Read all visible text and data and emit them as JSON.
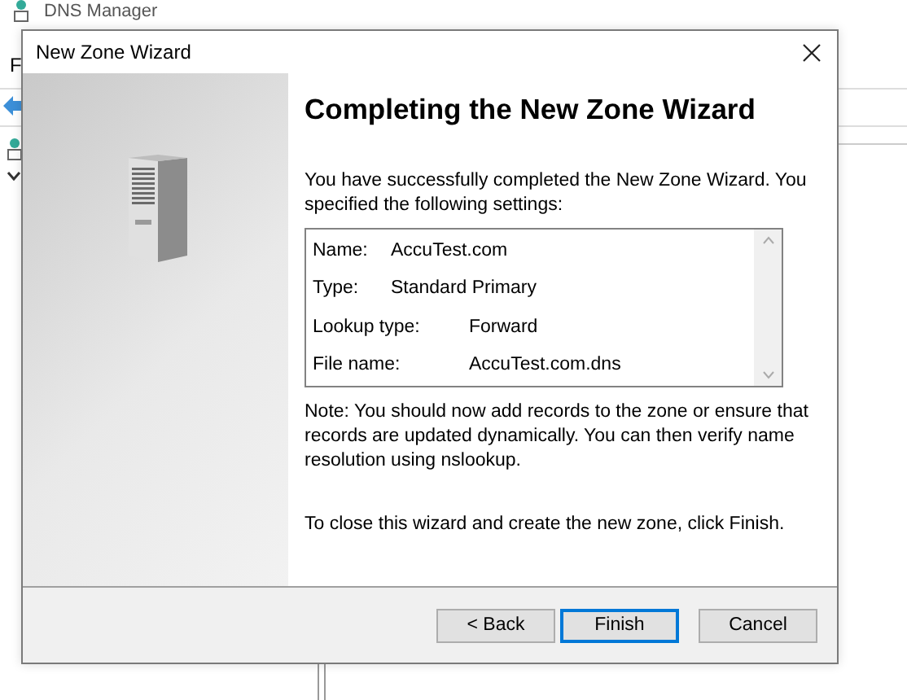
{
  "background_window": {
    "title": "DNS Manager",
    "menu_letter": "F"
  },
  "dialog": {
    "title": "New Zone Wizard",
    "heading": "Completing the New Zone Wizard",
    "intro": "You have successfully completed the New Zone Wizard. You specified the following settings:",
    "settings": [
      {
        "label": "Name:",
        "value": "AccuTest.com"
      },
      {
        "label": "Type:",
        "value": "Standard Primary"
      },
      {
        "label": "Lookup type:",
        "value": "Forward"
      },
      {
        "label": "File name:",
        "value": "AccuTest.com.dns"
      }
    ],
    "note": "Note: You should now add records to the zone or ensure that records are updated dynamically. You can then verify name resolution using nslookup.",
    "closing": "To close this wizard and create the new zone, click Finish.",
    "buttons": [
      {
        "label": "< Back",
        "selected": false
      },
      {
        "label": "Finish",
        "selected": true
      },
      {
        "label": "Cancel",
        "selected": false
      }
    ]
  }
}
